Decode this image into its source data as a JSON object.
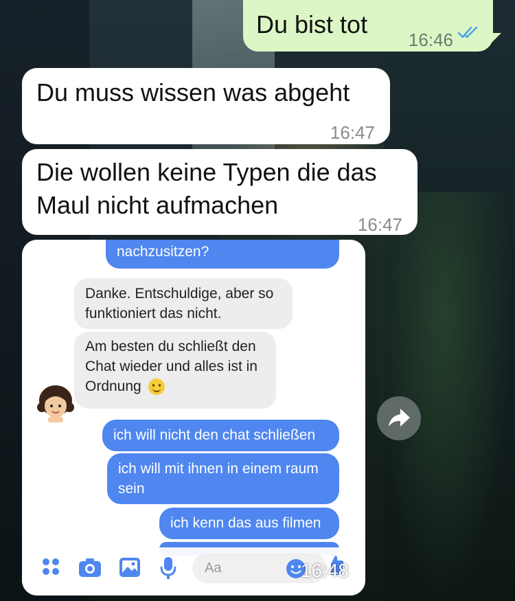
{
  "messages": [
    {
      "text": "Du bist tot",
      "time": "16:46",
      "direction": "outgoing",
      "status": "read"
    },
    {
      "text": "Du muss wissen was abgeht",
      "time": "16:47",
      "direction": "incoming"
    },
    {
      "text": "Die wollen keine Typen die das Maul nicht aufmachen",
      "time": "16:47",
      "direction": "incoming"
    }
  ],
  "embedded": {
    "time": "16:48",
    "chat": [
      {
        "text": "nachzusitzen?",
        "from": "me"
      },
      {
        "text": "Danke. Entschuldige, aber so funktioniert das nicht.",
        "from": "them"
      },
      {
        "text": "Am besten du schließt den Chat wieder und alles ist in Ordnung",
        "from": "them",
        "emoji": "slight-smile"
      },
      {
        "text": "ich will nicht den chat schließen",
        "from": "me"
      },
      {
        "text": "ich will mit ihnen in einem raum sein",
        "from": "me"
      },
      {
        "text": "ich kenn das aus filmen",
        "from": "me"
      }
    ],
    "composer": {
      "placeholder": "Aa",
      "icons": [
        "apps-icon",
        "camera-icon",
        "gallery-icon",
        "mic-icon",
        "emoji-icon",
        "like-icon"
      ]
    }
  },
  "colors": {
    "outgoing": "#dcf7c5",
    "incoming": "#ffffff",
    "messenger_blue": "#4f86ef",
    "read_ticks": "#4fa3e8"
  },
  "actions": {
    "forward_icon": "forward-icon"
  }
}
